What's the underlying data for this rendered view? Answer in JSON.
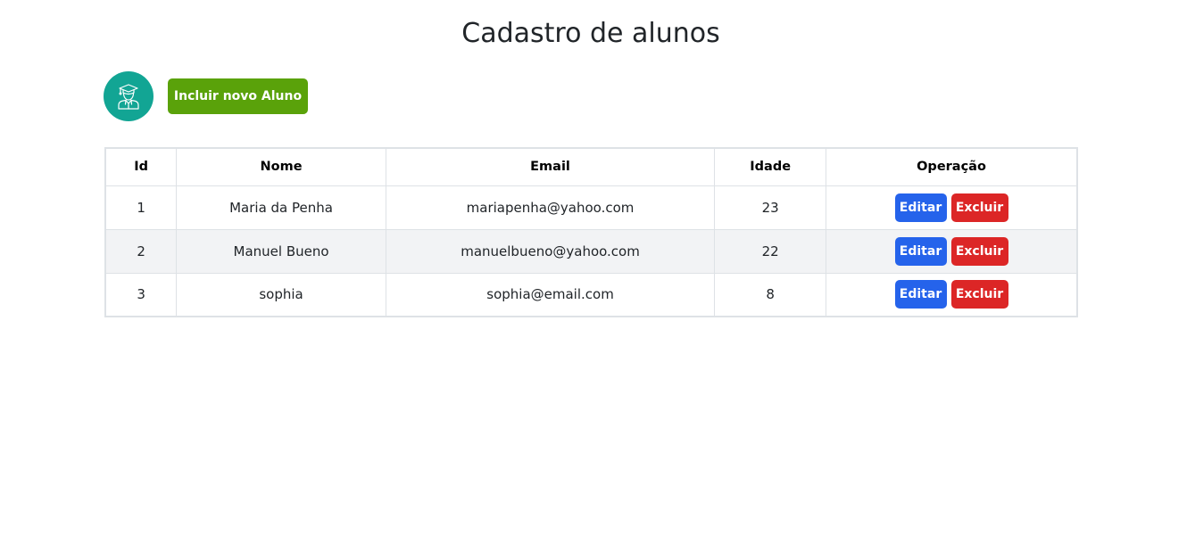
{
  "page": {
    "title": "Cadastro de alunos"
  },
  "toolbar": {
    "add_label": "Incluir novo Aluno",
    "avatar_icon": "graduate-student-icon"
  },
  "colors": {
    "avatar_bg": "#12a594",
    "add_button": "#5aa20a",
    "edit_button": "#2563eb",
    "delete_button": "#dc2626"
  },
  "table": {
    "headers": [
      "Id",
      "Nome",
      "Email",
      "Idade",
      "Operação"
    ],
    "rows": [
      {
        "id": "1",
        "nome": "Maria da Penha",
        "email": "mariapenha@yahoo.com",
        "idade": "23"
      },
      {
        "id": "2",
        "nome": "Manuel Bueno",
        "email": "manuelbueno@yahoo.com",
        "idade": "22"
      },
      {
        "id": "3",
        "nome": "sophia",
        "email": "sophia@email.com",
        "idade": "8"
      }
    ],
    "edit_label": "Editar",
    "delete_label": "Excluir"
  }
}
